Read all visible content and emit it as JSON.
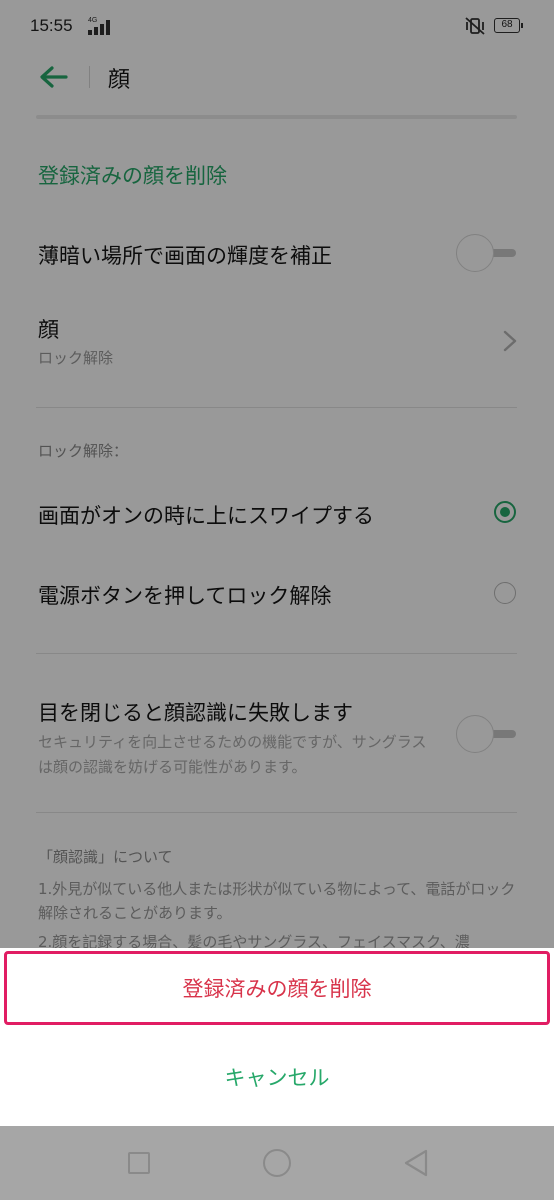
{
  "status_bar": {
    "time": "15:55",
    "network": "4G",
    "battery": "68"
  },
  "header": {
    "title": "顔"
  },
  "settings": {
    "delete_face_link": "登録済みの顔を削除",
    "brightness_row": {
      "title": "薄暗い場所で画面の輝度を補正",
      "enabled": false
    },
    "face_row": {
      "title": "顔",
      "subtitle": "ロック解除"
    },
    "unlock_section": {
      "heading": "ロック解除：",
      "options": [
        {
          "label": "画面がオンの時に上にスワイプする",
          "selected": true
        },
        {
          "label": "電源ボタンを押してロック解除",
          "selected": false
        }
      ]
    },
    "eyes_closed_row": {
      "title": "目を閉じると顔認識に失敗します",
      "description": "セキュリティを向上させるための機能ですが、サングラスは顔の認識を妨げる可能性があります。",
      "enabled": false
    },
    "about": {
      "title": "「顔認識」について",
      "item1": "1.外見が似ている他人または形状が似ている物によって、電話がロック解除されることがあります。",
      "item2": "2.顔を記録する場合、髪の毛やサングラス、フェイスマスク、濃"
    }
  },
  "action_sheet": {
    "delete_label": "登録済みの顔を削除",
    "cancel_label": "キャンセル"
  },
  "colors": {
    "accent": "#27a86a",
    "danger": "#d8334a",
    "highlight": "#e11d63"
  }
}
